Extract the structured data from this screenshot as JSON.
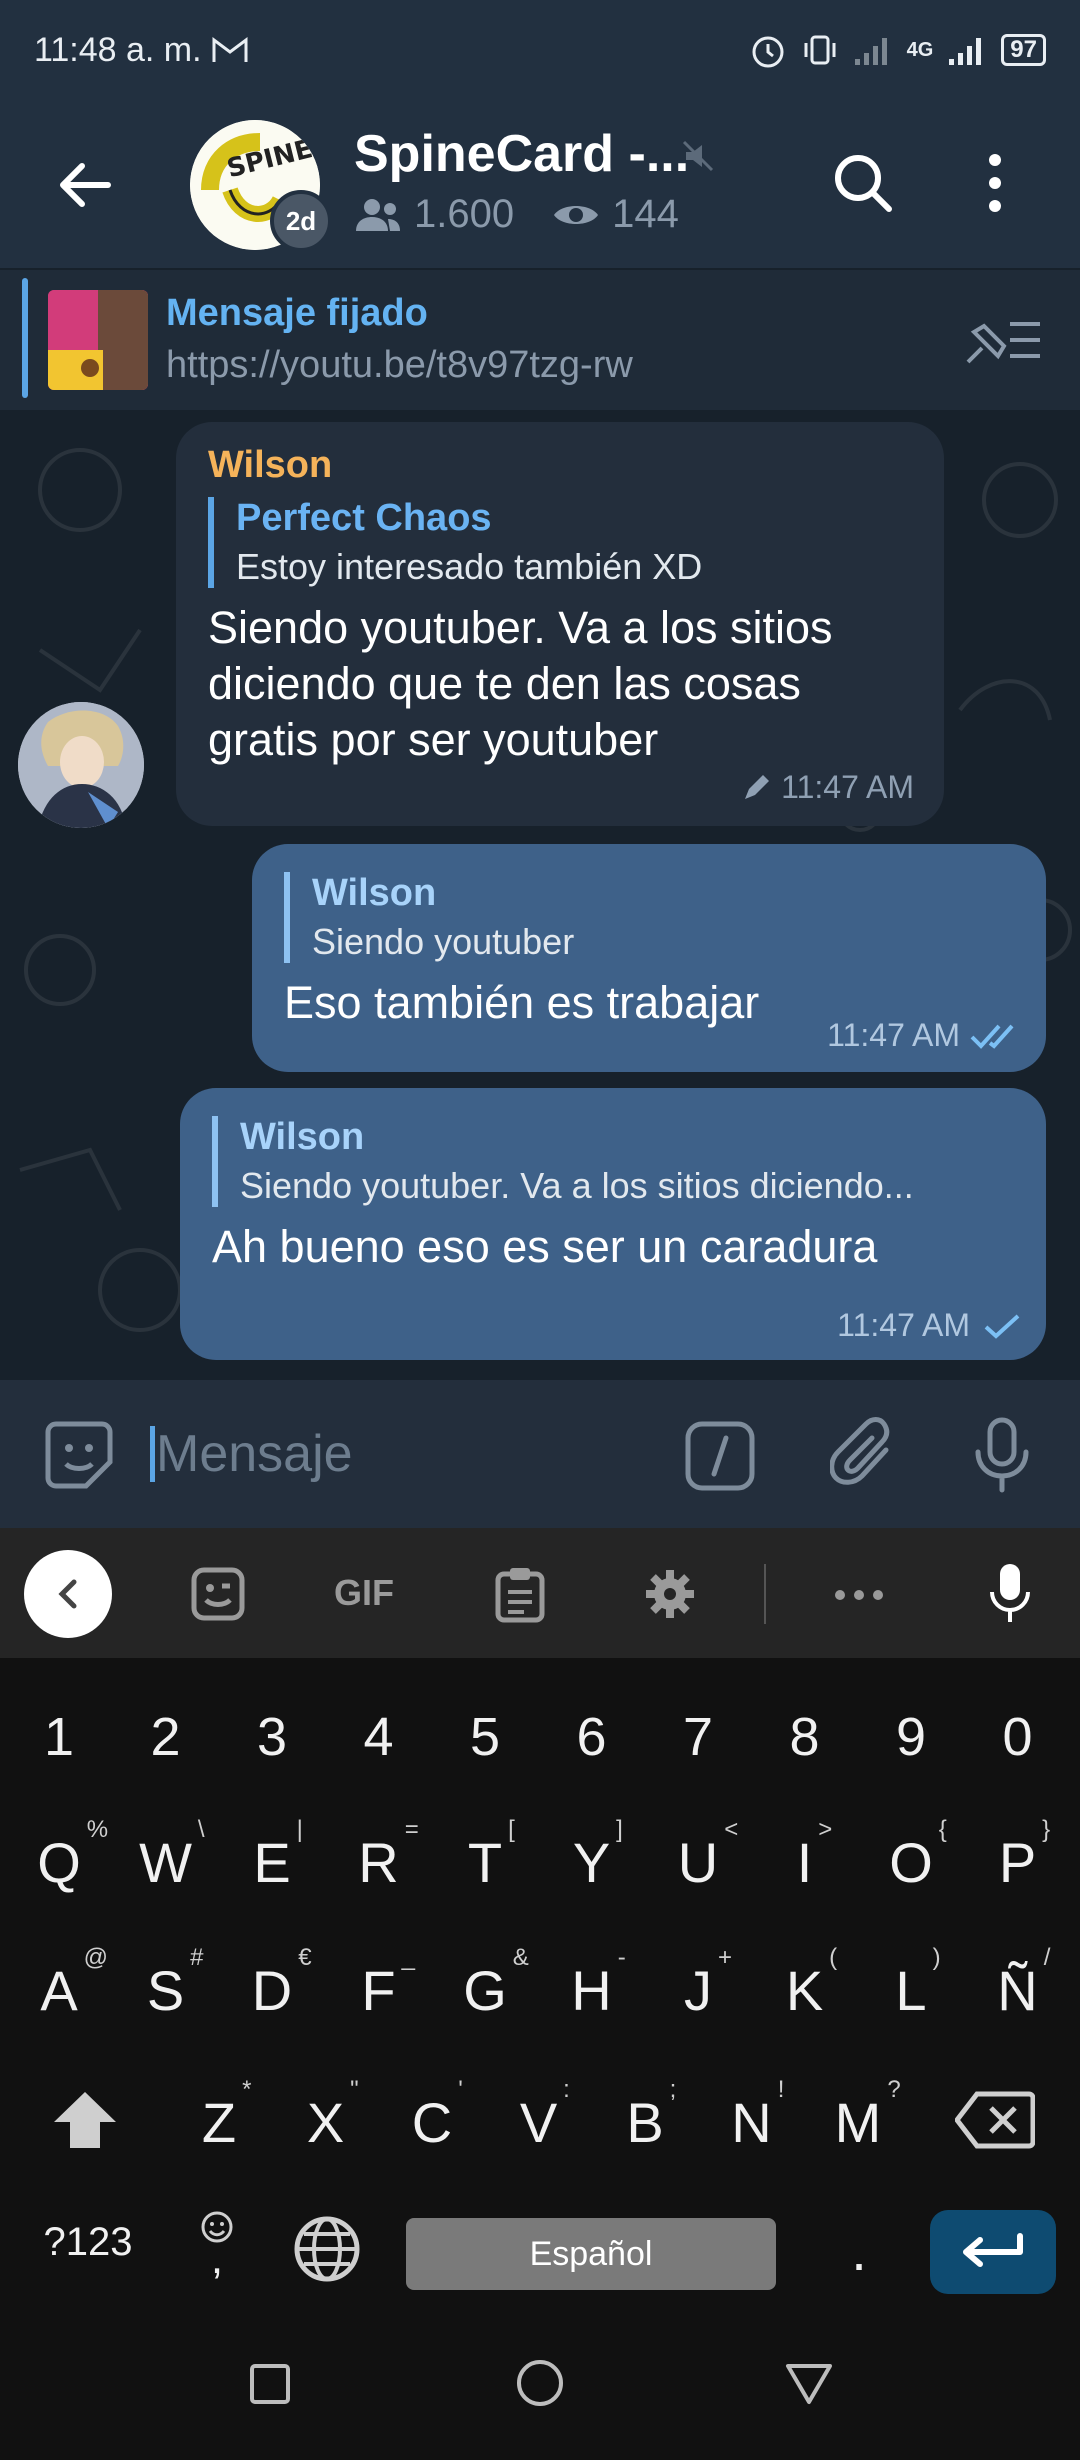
{
  "status": {
    "time": "11:48 a. m.",
    "network": "4G",
    "battery": "97"
  },
  "channel": {
    "title": "SpineCard -...",
    "members": "1.600",
    "views": "144",
    "badge": "2d",
    "logo_text": "SPINE"
  },
  "pinned": {
    "title": "Mensaje fijado",
    "text": "https://youtu.be/t8v97tzg-rw"
  },
  "messages": [
    {
      "sender": "Wilson",
      "reply_name": "Perfect Chaos",
      "reply_text": "Estoy interesado también XD",
      "text": "Siendo youtuber. Va a los sitios diciendo que te den las cosas gratis por ser youtuber",
      "time": "11:47 AM",
      "edited": true
    },
    {
      "reply_name": "Wilson",
      "reply_text": "Siendo youtuber",
      "text": "Eso también es trabajar",
      "time": "11:47 AM",
      "status": "read"
    },
    {
      "reply_name": "Wilson",
      "reply_text": "Siendo youtuber. Va a los sitios diciendo...",
      "text": "Ah bueno eso es ser un caradura",
      "time": "11:47 AM",
      "status": "sent"
    }
  ],
  "input": {
    "placeholder": "Mensaje"
  },
  "keyboard": {
    "gif_label": "GIF",
    "numbers": [
      "1",
      "2",
      "3",
      "4",
      "5",
      "6",
      "7",
      "8",
      "9",
      "0"
    ],
    "row1": [
      [
        "Q",
        "%"
      ],
      [
        "W",
        "\\"
      ],
      [
        "E",
        "|"
      ],
      [
        "R",
        "="
      ],
      [
        "T",
        "["
      ],
      [
        "Y",
        "]"
      ],
      [
        "U",
        "<"
      ],
      [
        "I",
        ">"
      ],
      [
        "O",
        "{"
      ],
      [
        "P",
        "}"
      ]
    ],
    "row2": [
      [
        "A",
        "@"
      ],
      [
        "S",
        "#"
      ],
      [
        "D",
        "€"
      ],
      [
        "F",
        "_"
      ],
      [
        "G",
        "&"
      ],
      [
        "H",
        "-"
      ],
      [
        "J",
        "+"
      ],
      [
        "K",
        "("
      ],
      [
        "L",
        ")"
      ],
      [
        "Ñ",
        "/"
      ]
    ],
    "row3": [
      [
        "Z",
        "*"
      ],
      [
        "X",
        "\""
      ],
      [
        "C",
        "'"
      ],
      [
        "V",
        ":"
      ],
      [
        "B",
        ";"
      ],
      [
        "N",
        "!"
      ],
      [
        "M",
        "?"
      ]
    ],
    "symbols_label": "?123",
    "comma": ",",
    "space_label": "Español",
    "period": "."
  },
  "colors": {
    "accent": "#5ba5e5",
    "outgoing": "#3e6189",
    "incoming": "#232e3c",
    "sender_name": "#f5b35a"
  }
}
